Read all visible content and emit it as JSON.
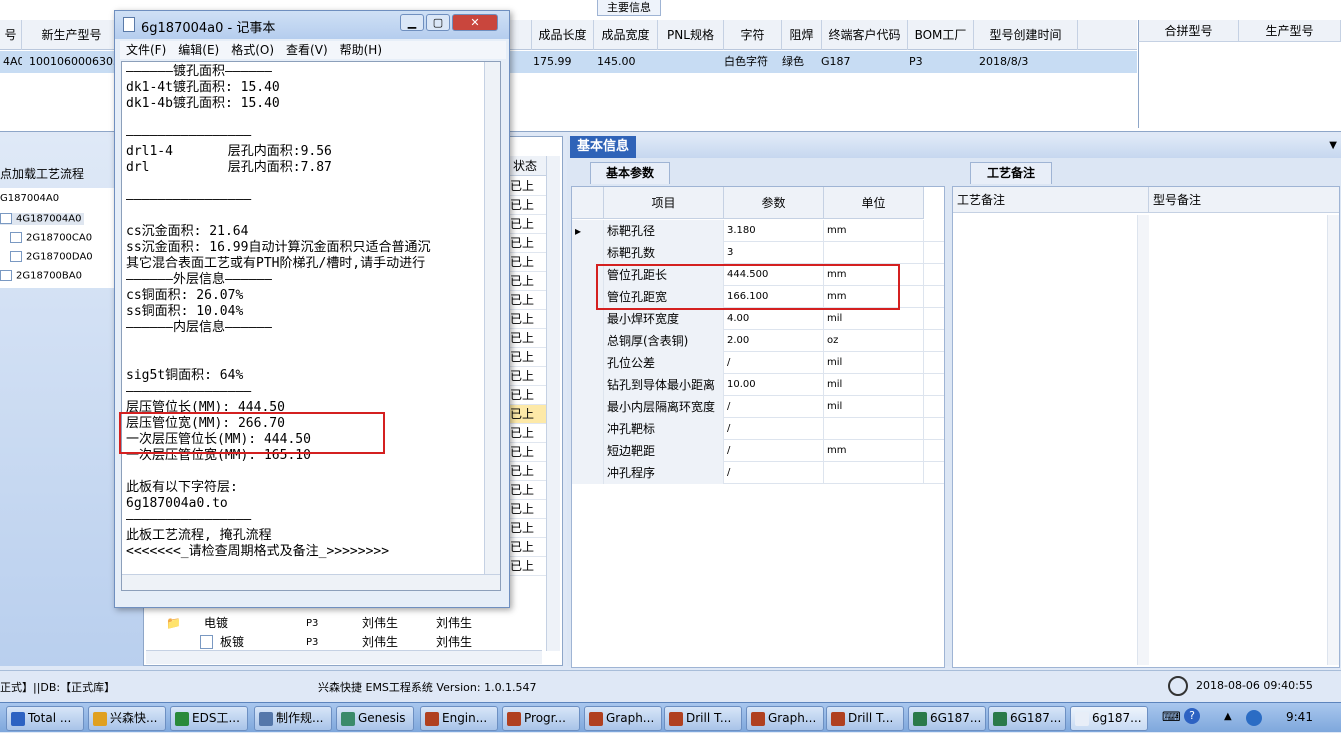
{
  "top": {
    "tab_label": "主要信息",
    "headers": [
      "号",
      "新生产型号",
      "成品长度",
      "成品宽度",
      "PNL规格",
      "字符",
      "阻焊",
      "终端客户代码",
      "BOM工厂",
      "型号创建时间"
    ],
    "row": [
      "4A0",
      "10010600063031",
      "175.99",
      "145.00",
      "",
      "白色字符",
      "绿色",
      "G187",
      "P3",
      "2018/8/3"
    ],
    "right_headers": [
      "合拼型号",
      "生产型号"
    ]
  },
  "left": {
    "load_label": "点加载工艺流程",
    "tree": [
      "G187004A0",
      "4G187004A0",
      "2G18700CA0",
      "2G18700DA0",
      "2G18700BA0"
    ]
  },
  "mid": {
    "status_header": "状态",
    "status_value": "已上",
    "bottom_rows": [
      {
        "name": "电镀",
        "factory": "P3",
        "u1": "刘伟生",
        "u2": "刘伟生",
        "status": "已上"
      },
      {
        "name": "板镀",
        "factory": "P3",
        "u1": "刘伟生",
        "u2": "刘伟生",
        "status": "已上"
      }
    ]
  },
  "info": {
    "tab_label": "基本信息",
    "param_tab": "基本参数",
    "notes_tab": "工艺备注",
    "headers": [
      "项目",
      "参数",
      "单位"
    ],
    "rows": [
      {
        "item": "标靶孔径",
        "value": "3.180",
        "unit": "mm"
      },
      {
        "item": "标靶孔数",
        "value": "3",
        "unit": ""
      },
      {
        "item": "管位孔距长",
        "value": "444.500",
        "unit": "mm"
      },
      {
        "item": "管位孔距宽",
        "value": "166.100",
        "unit": "mm"
      },
      {
        "item": "最小焊环宽度",
        "value": "4.00",
        "unit": "mil"
      },
      {
        "item": "总铜厚(含表铜)",
        "value": "2.00",
        "unit": "oz"
      },
      {
        "item": "孔位公差",
        "value": "/",
        "unit": "mil"
      },
      {
        "item": "钻孔到导体最小距离",
        "value": "10.00",
        "unit": "mil"
      },
      {
        "item": "最小内层隔离环宽度",
        "value": "/",
        "unit": "mil"
      },
      {
        "item": "冲孔靶标",
        "value": "/",
        "unit": ""
      },
      {
        "item": "短边靶距",
        "value": "/",
        "unit": "mm"
      },
      {
        "item": "冲孔程序",
        "value": "/",
        "unit": ""
      }
    ],
    "notes_headers": [
      "工艺备注",
      "型号备注"
    ]
  },
  "notepad": {
    "title": "6g187004a0 - 记事本",
    "menu": [
      "文件(F)",
      "编辑(E)",
      "格式(O)",
      "查看(V)",
      "帮助(H)"
    ],
    "lines": [
      "——————镀孔面积——————",
      "dk1-4t镀孔面积: 15.40",
      "dk1-4b镀孔面积: 15.40",
      "",
      "————————————————",
      "drl1-4       层孔内面积:9.56",
      "drl          层孔内面积:7.87",
      "",
      "————————————————",
      "",
      "cs沉金面积: 21.64",
      "ss沉金面积: 16.99自动计算沉金面积只适合普通沉",
      "其它混合表面工艺或有PTH阶梯孔/槽时,请手动进行",
      "——————外层信息——————",
      "cs铜面积: 26.07%",
      "ss铜面积: 10.04%",
      "——————内层信息——————",
      "",
      "",
      "sig5t铜面积: 64%",
      "————————————————",
      "层压管位长(MM): 444.50",
      "层压管位宽(MM): 266.70",
      "一次层压管位长(MM): 444.50",
      "一次层压管位宽(MM): 165.10",
      "",
      "此板有以下字符层:",
      "6g187004a0.to",
      "————————————————",
      "此板工艺流程, 掩孔流程",
      "<<<<<<<_请检查周期格式及备注_>>>>>>>>"
    ]
  },
  "status": {
    "left": "正式】||DB:【正式库】",
    "center": "兴森快捷 EMS工程系统 Version: 1.0.1.547",
    "datetime": "2018-08-06 09:40:55"
  },
  "taskbar": {
    "items": [
      "Total ...",
      "兴森快...",
      "EDS工...",
      "制作规...",
      "Genesis",
      "Engin...",
      "Progr...",
      "Graph...",
      "Drill T...",
      "Graph...",
      "Drill T...",
      "6G187...",
      "6G187...",
      "6g187..."
    ],
    "time": "9:41"
  }
}
